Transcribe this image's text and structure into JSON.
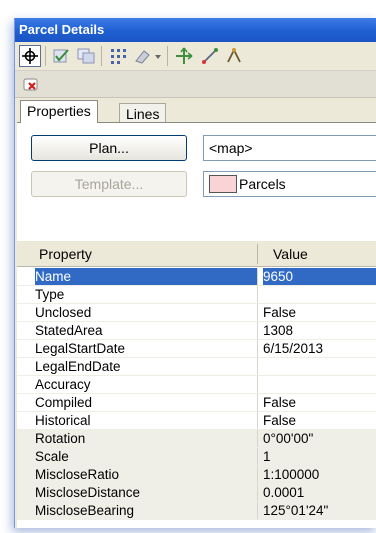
{
  "window": {
    "title": "Parcel Details"
  },
  "tabs": {
    "properties": "Properties",
    "lines": "Lines"
  },
  "buttons": {
    "plan": "Plan...",
    "template": "Template..."
  },
  "fields": {
    "plan_value": "<map>",
    "template_value": "Parcels",
    "template_swatch_color": "#f9d3d6"
  },
  "grid": {
    "headers": {
      "property": "Property",
      "value": "Value"
    },
    "rows": [
      {
        "property": "Name",
        "value": "9650",
        "selected": true
      },
      {
        "property": "Type",
        "value": ""
      },
      {
        "property": "Unclosed",
        "value": "False"
      },
      {
        "property": "StatedArea",
        "value": "1308"
      },
      {
        "property": "LegalStartDate",
        "value": "6/15/2013"
      },
      {
        "property": "LegalEndDate",
        "value": ""
      },
      {
        "property": "Accuracy",
        "value": ""
      },
      {
        "property": "Compiled",
        "value": "False"
      },
      {
        "property": "Historical",
        "value": "False"
      },
      {
        "property": "Rotation",
        "value": "0°00'00\"",
        "shaded": true
      },
      {
        "property": "Scale",
        "value": "1",
        "shaded": true
      },
      {
        "property": "MiscloseRatio",
        "value": "1:100000",
        "shaded": true
      },
      {
        "property": "MiscloseDistance",
        "value": "0.0001",
        "shaded": true
      },
      {
        "property": "MiscloseBearing",
        "value": "125°01'24\"",
        "shaded": true
      }
    ]
  },
  "colors": {
    "title_bar": "#1f5fd0",
    "selection": "#316ac5"
  },
  "icons": [
    "pan-crosshair-icon",
    "check-edit-icon",
    "select-features-icon",
    "grid-points-icon",
    "tool-dropdown-icon",
    "rotate-parcel-icon",
    "line-tool-icon",
    "extra-tool-icon",
    "remove-parcel-icon"
  ]
}
